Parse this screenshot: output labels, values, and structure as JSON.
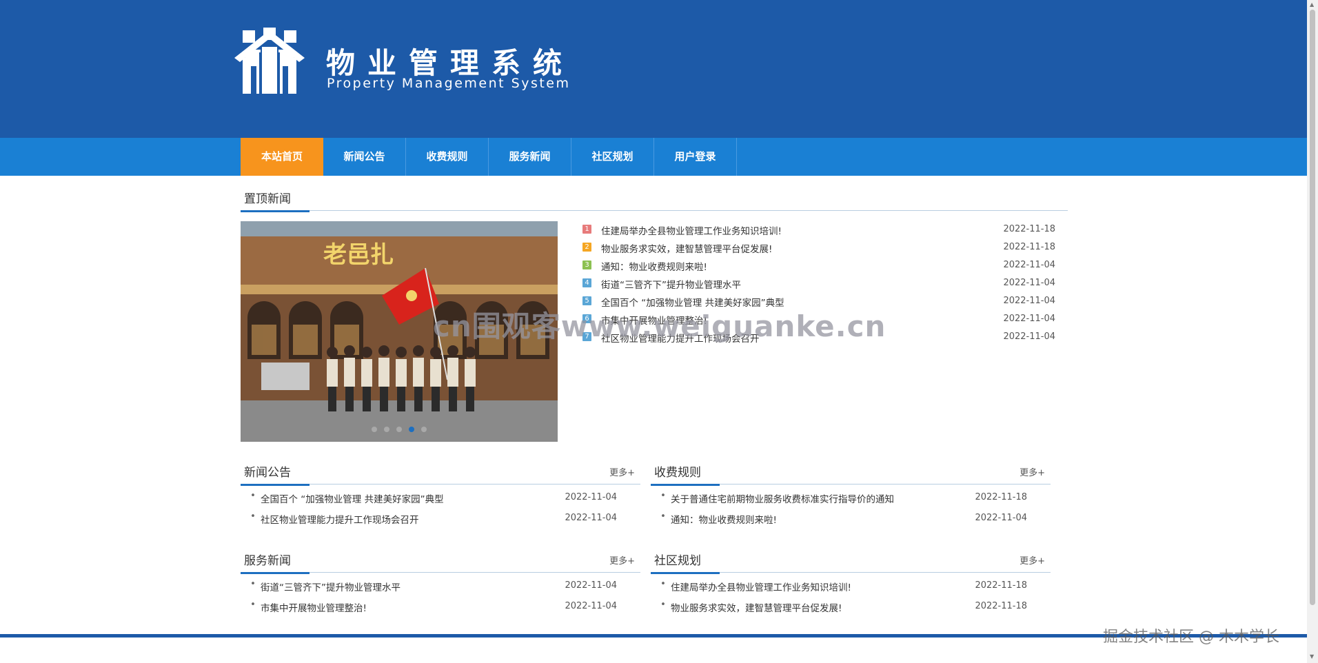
{
  "header": {
    "title": "物业管理系统",
    "subtitle": "Property Management System",
    "background_color": "#1d5aa8"
  },
  "nav": {
    "background_color": "#1a80d4",
    "active_color": "#f7941d",
    "items": [
      {
        "label": "本站首页",
        "active": true
      },
      {
        "label": "新闻公告",
        "active": false
      },
      {
        "label": "收费规则",
        "active": false
      },
      {
        "label": "服务新闻",
        "active": false
      },
      {
        "label": "社区规划",
        "active": false
      },
      {
        "label": "用户登录",
        "active": false
      }
    ]
  },
  "top_news": {
    "title": "置顶新闻",
    "carousel": {
      "slide_count": 5,
      "active_index": 3
    },
    "items": [
      {
        "num": "1",
        "badge_color": "#e77b7b",
        "title": "住建局举办全县物业管理工作业务知识培训!",
        "date": "2022-11-18"
      },
      {
        "num": "2",
        "badge_color": "#f5a623",
        "title": "物业服务求实效，建智慧管理平台促发展!",
        "date": "2022-11-18"
      },
      {
        "num": "3",
        "badge_color": "#8cc152",
        "title": "通知：物业收费规则来啦!",
        "date": "2022-11-04"
      },
      {
        "num": "4",
        "badge_color": "#5aa6d6",
        "title": "街道“三管齐下”提升物业管理水平",
        "date": "2022-11-04"
      },
      {
        "num": "5",
        "badge_color": "#5aa6d6",
        "title": "全国百个 “加强物业管理 共建美好家园”典型",
        "date": "2022-11-04"
      },
      {
        "num": "6",
        "badge_color": "#5aa6d6",
        "title": "市集中开展物业管理整治!",
        "date": "2022-11-04"
      },
      {
        "num": "7",
        "badge_color": "#5aa6d6",
        "title": "社区物业管理能力提升工作现场会召开",
        "date": "2022-11-04"
      }
    ]
  },
  "sections": {
    "news": {
      "title": "新闻公告",
      "more": "更多+",
      "items": [
        {
          "title": "全国百个 “加强物业管理 共建美好家园”典型",
          "date": "2022-11-04"
        },
        {
          "title": "社区物业管理能力提升工作现场会召开",
          "date": "2022-11-04"
        }
      ]
    },
    "fees": {
      "title": "收费规则",
      "more": "更多+",
      "items": [
        {
          "title": "关于普通住宅前期物业服务收费标准实行指导价的通知",
          "date": "2022-11-18"
        },
        {
          "title": "通知：物业收费规则来啦!",
          "date": "2022-11-04"
        }
      ]
    },
    "service": {
      "title": "服务新闻",
      "more": "更多+",
      "items": [
        {
          "title": "街道“三管齐下”提升物业管理水平",
          "date": "2022-11-04"
        },
        {
          "title": "市集中开展物业管理整治!",
          "date": "2022-11-04"
        }
      ]
    },
    "planning": {
      "title": "社区规划",
      "more": "更多+",
      "items": [
        {
          "title": "住建局举办全县物业管理工作业务知识培训!",
          "date": "2022-11-18"
        },
        {
          "title": "物业服务求实效，建智慧管理平台促发展!",
          "date": "2022-11-18"
        }
      ]
    }
  },
  "overlays": {
    "watermark": "cn围观客www.weiguanke.cn",
    "credit": "掘金技术社区 @ 木木学长"
  },
  "icons": {
    "logo": "house-people-logo-icon",
    "bullet": "dot-bullet-icon"
  }
}
